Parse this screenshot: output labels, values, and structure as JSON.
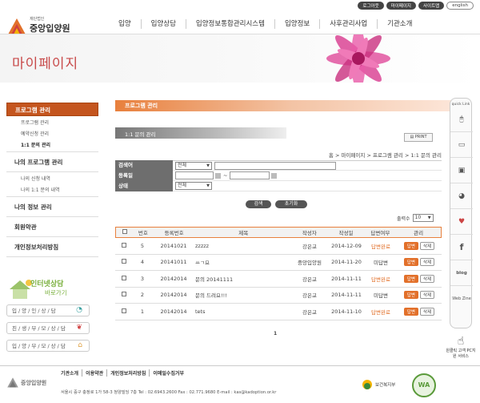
{
  "util": {
    "logout": "로그아웃",
    "mypage": "마이페이지",
    "sitemap": "사이트맵",
    "english": "english"
  },
  "logo": {
    "prefix": "재단법인",
    "name": "중앙입양원",
    "en": "KOREA ADOPTION SERVICES"
  },
  "gnb": [
    "입양",
    "입양상담",
    "입양정보통합관리시스템",
    "입양정보",
    "사후관리사업",
    "기관소개"
  ],
  "banner": {
    "title": "마이페이지"
  },
  "lnb": {
    "program": "프로그램 관리",
    "program_items": [
      "프로그램 관리",
      "예약신청 관리",
      "1:1 문의 관리"
    ],
    "my_program": "나의 프로그램 관리",
    "my_items": [
      "나의 신청 내역",
      "나의 1:1 문의 내역"
    ],
    "my_info": "나의 정보 관리",
    "terms": "회원약관",
    "privacy": "개인정보처리방침"
  },
  "promo": {
    "line1": "인터넷상담",
    "line2": "바로가기"
  },
  "left_buttons": [
    "입/양/인/상/담",
    "친/생/부/모/상/담",
    "입/양/부/모/상/담"
  ],
  "content": {
    "crumb_bar": "프로그램 관리",
    "subhead": "1:1 문의 관리",
    "print": "PRINT",
    "path": "홈 > 마이페이지 > 프로그램 관리 > 1:1 문의 관리"
  },
  "search": {
    "keyword_label": "검색어",
    "keyword_select": "전체",
    "date_label": "등록일",
    "date_sep": "~",
    "status_label": "상태",
    "status_select": "전체",
    "search_btn": "검색",
    "reset_btn": "초기화"
  },
  "list": {
    "rpp_label": "출력수",
    "rpp_value": "10",
    "headers": [
      "번호",
      "등록번호",
      "제목",
      "작성자",
      "작성일",
      "답변여부",
      "관리"
    ],
    "rows": [
      {
        "no": "5",
        "reg": "20141021",
        "title": "zzzzz",
        "writer": "강은교",
        "date": "2014-12-09",
        "status": "답변완료",
        "done": true
      },
      {
        "no": "4",
        "reg": "20141011",
        "title": "ㅛㄱ요",
        "writer": "중앙입양원",
        "date": "2014-11-20",
        "status": "미답변",
        "done": false
      },
      {
        "no": "3",
        "reg": "20142014",
        "title": "문의 20141111",
        "writer": "강은교",
        "date": "2014-11-11",
        "status": "답변완료",
        "done": true
      },
      {
        "no": "2",
        "reg": "20142014",
        "title": "문의 드려요!!!",
        "writer": "강은교",
        "date": "2014-11-11",
        "status": "미답변",
        "done": false
      },
      {
        "no": "1",
        "reg": "20142014",
        "title": "tets",
        "writer": "강은교",
        "date": "2014-11-10",
        "status": "답변완료",
        "done": true
      }
    ],
    "answer_btn": "답변",
    "delete_btn": "삭제",
    "page": "1"
  },
  "quick": {
    "title": "quick Link",
    "blog": "blog",
    "webzine": "Web Zine",
    "remote": "원클릭 고객 PC지원 서비스"
  },
  "footer": {
    "logo": "중앙입양원",
    "links": [
      "기관소개",
      "이용약관",
      "개인정보처리방침",
      "이메일수집거부"
    ],
    "address": "서울시 중구 충정로 1가 58-3 청양빌딩 7층 Tel : 02.6943.2600   Fax : 02.771.9680  E-mail : kas@kadoption.or.kr",
    "ministry": "보건복지부",
    "wa": "WA"
  },
  "colors": {
    "accent": "#e2702a",
    "lnb_head": "#c4551e",
    "banner_title": "#c84a4a"
  }
}
